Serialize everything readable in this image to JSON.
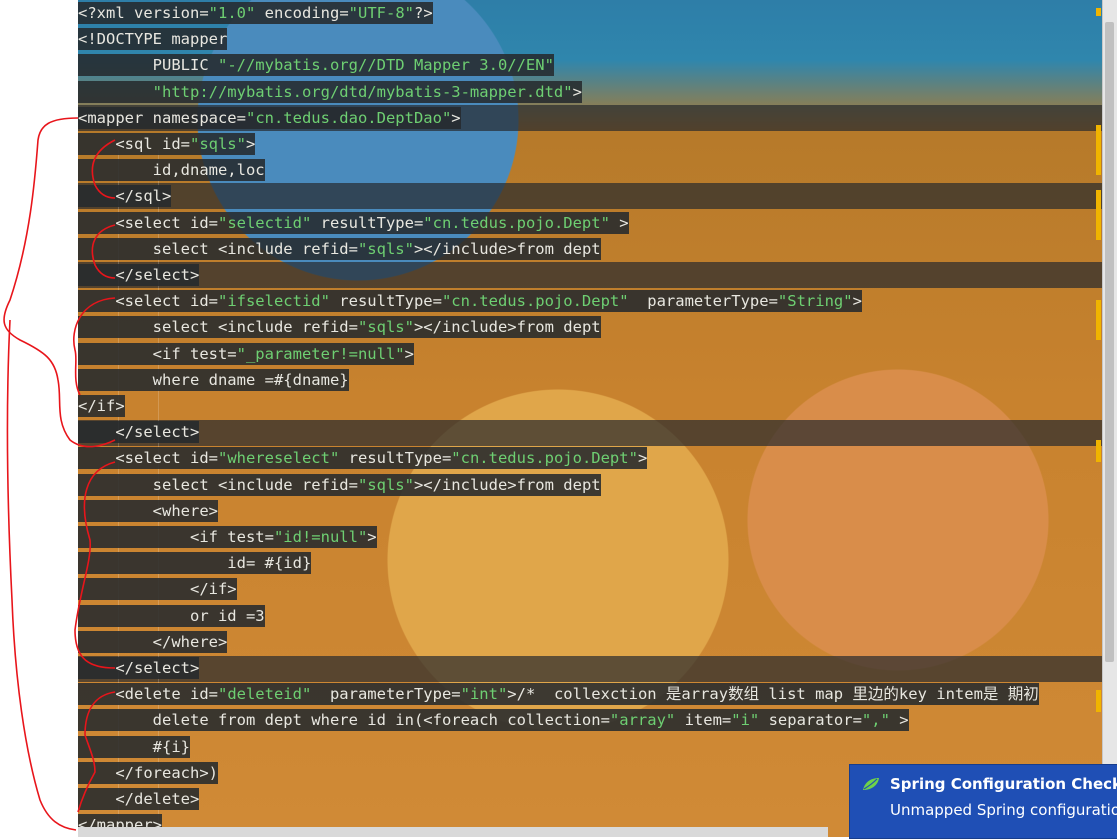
{
  "editor": {
    "lines": [
      {
        "text": "<?xml version=\"1.0\" encoding=\"UTF-8\"?>"
      },
      {
        "text": "<!DOCTYPE mapper"
      },
      {
        "text": "        PUBLIC \"-//mybatis.org//DTD Mapper 3.0//EN\""
      },
      {
        "text": "        \"http://mybatis.org/dtd/mybatis-3-mapper.dtd\">"
      },
      {
        "text": "<mapper namespace=\"cn.tedus.dao.DeptDao\">"
      },
      {
        "text": "    <sql id=\"sqls\">"
      },
      {
        "text": "        id,dname,loc"
      },
      {
        "text": "    </sql>"
      },
      {
        "text": "    <select id=\"selectid\" resultType=\"cn.tedus.pojo.Dept\" >"
      },
      {
        "text": "        select <include refid=\"sqls\"></include>from dept"
      },
      {
        "text": "    </select>"
      },
      {
        "text": "    <select id=\"ifselectid\" resultType=\"cn.tedus.pojo.Dept\"  parameterType=\"String\">"
      },
      {
        "text": "        select <include refid=\"sqls\"></include>from dept"
      },
      {
        "text": "        <if test=\"_parameter!=null\">"
      },
      {
        "text": "        where dname =#{dname}"
      },
      {
        "text": "</if>"
      },
      {
        "text": "    </select>"
      },
      {
        "text": "    <select id=\"whereselect\" resultType=\"cn.tedus.pojo.Dept\">"
      },
      {
        "text": "        select <include refid=\"sqls\"></include>from dept"
      },
      {
        "text": "        <where>"
      },
      {
        "text": "            <if test=\"id!=null\">"
      },
      {
        "text": "                id= #{id}"
      },
      {
        "text": "            </if>"
      },
      {
        "text": "            or id =3"
      },
      {
        "text": "        </where>"
      },
      {
        "text": "    </select>"
      },
      {
        "text": "    <delete id=\"deleteid\"  parameterType=\"int\">/*  collexction 是array数组 list map 里边的key intem是 期初"
      },
      {
        "text": "        delete from dept where id in(<foreach collection=\"array\" item=\"i\" separator=\",\" >"
      },
      {
        "text": "        #{i}"
      },
      {
        "text": "    </foreach>)"
      },
      {
        "text": "    </delete>"
      },
      {
        "text": "</mapper>"
      }
    ]
  },
  "notification": {
    "title": "Spring Configuration Check",
    "body": "Unmapped Spring configuration"
  },
  "colors": {
    "string": "#6ecf72",
    "highlight": "#262a2e",
    "popup": "#1f4fb5",
    "annotation": "#e8151b"
  },
  "icons": {
    "popup_icon": "spring-leaf-icon"
  }
}
